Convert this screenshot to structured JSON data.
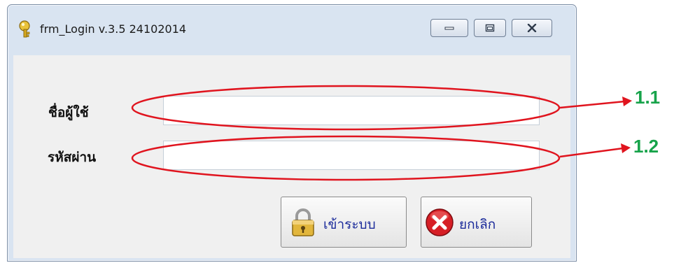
{
  "window": {
    "title": "frm_Login v.3.5 24102014",
    "app_icon": "key-icon",
    "caption_buttons": [
      "minimize-icon",
      "maximize-icon",
      "close-icon"
    ]
  },
  "form": {
    "username_label": "ชื่อผู้ใช้",
    "password_label": "รหัสผ่าน",
    "username_value": "",
    "password_value": ""
  },
  "buttons": {
    "login_label": "เข้าระบบ",
    "login_icon": "padlock-icon",
    "cancel_label": "ยกเลิก",
    "cancel_icon": "cancel-x-icon"
  },
  "annotations": {
    "callout_1": "1.1",
    "callout_2": "1.2",
    "circle_color": "#e0141e",
    "callout_color": "#17a34a"
  }
}
